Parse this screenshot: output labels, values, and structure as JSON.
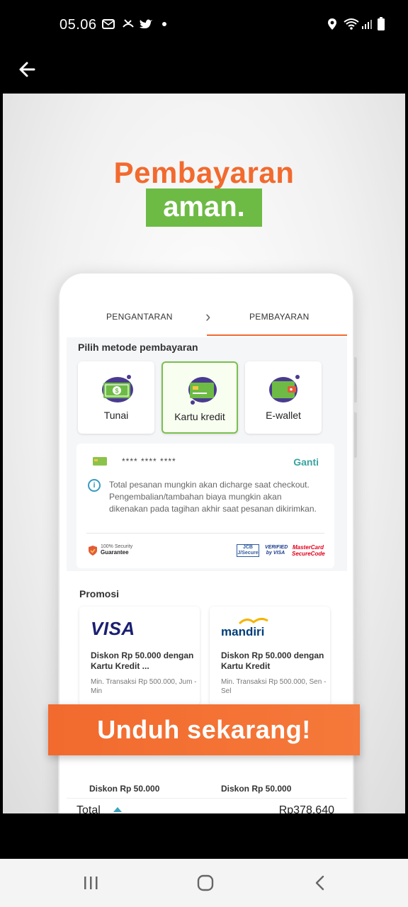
{
  "status_bar": {
    "time": "05.06",
    "icons": [
      "message-icon",
      "missed-call-icon",
      "twitter-icon",
      "dot-icon",
      "location-icon",
      "wifi-icon",
      "signal-icon",
      "battery-icon"
    ]
  },
  "app_bar": {
    "back_icon": "arrow-left-icon"
  },
  "hero": {
    "line1": "Pembayaran",
    "line2": "aman."
  },
  "checkout": {
    "steps": [
      "PENGANTARAN",
      "PEMBAYARAN"
    ],
    "active_step": "PEMBAYARAN",
    "section_title": "Pilih metode pembayaran",
    "methods": [
      {
        "label": "Tunai",
        "icon": "cash-icon",
        "selected": false
      },
      {
        "label": "Kartu kredit",
        "icon": "credit-card-icon",
        "selected": true
      },
      {
        "label": "E-wallet",
        "icon": "wallet-icon",
        "selected": false
      }
    ],
    "card_mask": "**** **** ****",
    "change_label": "Ganti",
    "notice": "Total pesanan mungkin akan dicharge saat checkout. Pengembalian/tambahan biaya mungkin akan dikenakan pada tagihan akhir saat pesanan dikirimkan.",
    "security_badge": {
      "line1": "100% Security",
      "line2": "Guarantee"
    },
    "brand_logos": {
      "jcb": "JCB J/Secure",
      "vbv": "VERIFIED by VISA",
      "mc": "MasterCard SecureCode"
    },
    "promo_title": "Promosi",
    "promos": [
      {
        "brand": "VISA",
        "desc": "Diskon Rp 50.000 dengan Kartu Kredit ...",
        "min": "Min. Transaksi Rp 500.000, Jum - Min"
      },
      {
        "brand": "mandiri",
        "desc": "Diskon Rp 50.000 dengan Kartu Kredit",
        "min": "Min. Transaksi Rp 500.000, Sen - Sel"
      }
    ],
    "promo_peek": [
      "Diskon Rp 50.000",
      "Diskon Rp 50.000"
    ],
    "total_label": "Total",
    "total_value": "Rp378,640"
  },
  "cta": {
    "label": "Unduh sekarang!"
  },
  "colors": {
    "accent_orange": "#f26a2e",
    "accent_green": "#6dbb45",
    "teal": "#3aa3a0"
  },
  "nav": {
    "icons": [
      "recent-apps-icon",
      "home-icon",
      "back-icon"
    ]
  }
}
